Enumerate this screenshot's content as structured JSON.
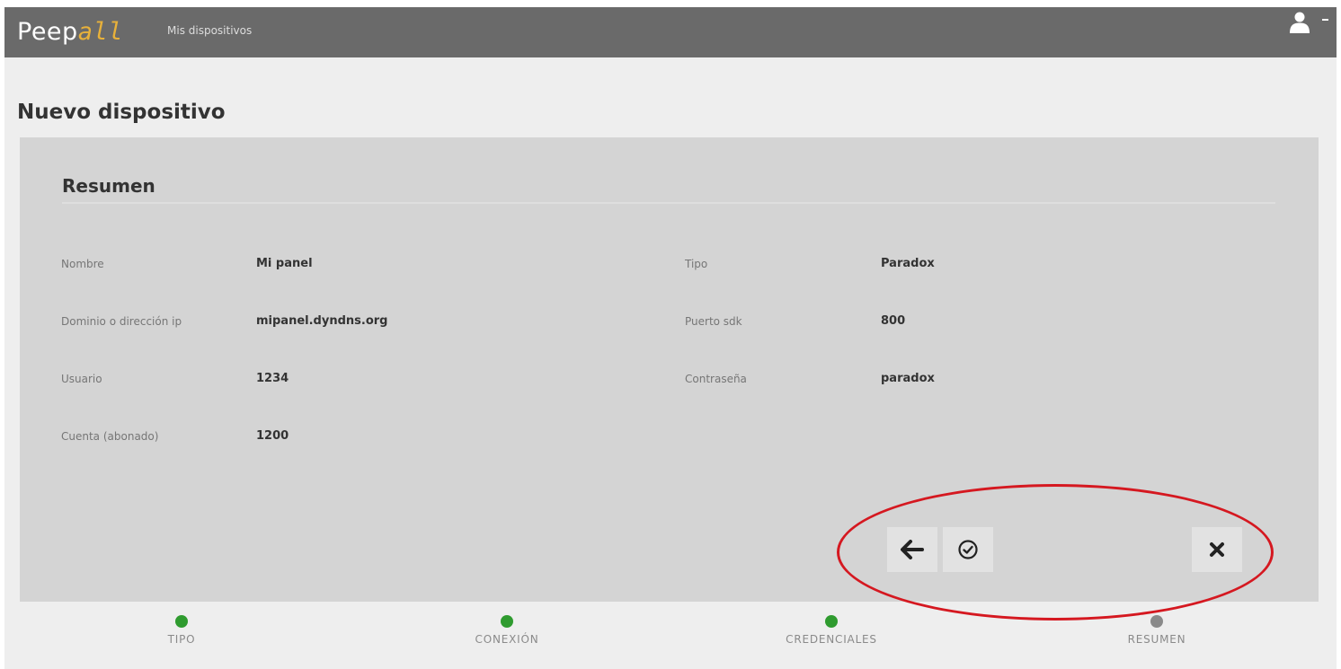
{
  "header": {
    "brand_plain": "Peep",
    "brand_accent": "all",
    "nav_link": "Mis dispositivos",
    "user_icon": "user-icon",
    "caret_icon": "caret-down-icon"
  },
  "page": {
    "title": "Nuevo dispositivo"
  },
  "summary": {
    "title": "Resumen",
    "fields": [
      {
        "label": "Nombre",
        "value": "Mi panel"
      },
      {
        "label": "Tipo",
        "value": "Paradox"
      },
      {
        "label": "Dominio o dirección ip",
        "value": "mipanel.dyndns.org"
      },
      {
        "label": "Puerto sdk",
        "value": "800"
      },
      {
        "label": "Usuario",
        "value": "1234"
      },
      {
        "label": "Contraseña",
        "value": "paradox"
      },
      {
        "label": "Cuenta (abonado)",
        "value": "1200"
      }
    ]
  },
  "actions": {
    "back_icon": "arrow-left-icon",
    "confirm_icon": "check-circle-icon",
    "cancel_icon": "close-icon"
  },
  "steps": [
    {
      "label": "TIPO",
      "status": "done"
    },
    {
      "label": "CONEXIÓN",
      "status": "done"
    },
    {
      "label": "CREDENCIALES",
      "status": "done"
    },
    {
      "label": "RESUMEN",
      "status": "pending"
    }
  ],
  "colors": {
    "header_bg": "#6a6a6a",
    "brand_accent": "#e8b13a",
    "panel_bg": "#d4d4d4",
    "step_done": "#2f9b2f",
    "step_pending": "#8a8a8a",
    "annotation": "#d51820"
  }
}
